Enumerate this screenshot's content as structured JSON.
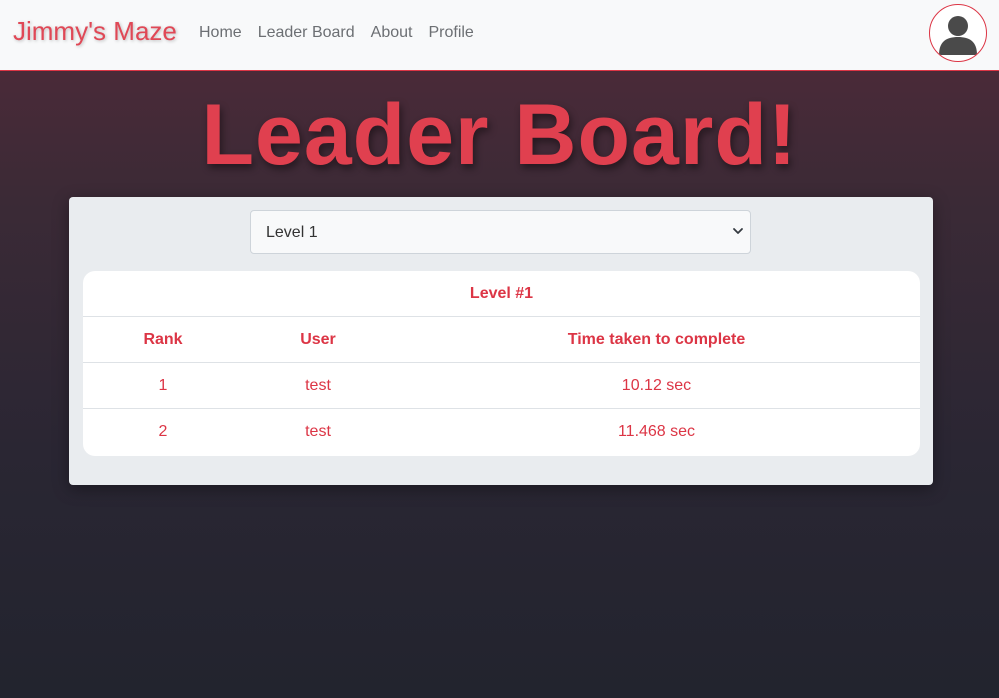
{
  "navbar": {
    "brand": "Jimmy's Maze",
    "links": [
      "Home",
      "Leader Board",
      "About",
      "Profile"
    ]
  },
  "page": {
    "title": "Leader Board!"
  },
  "level_select": {
    "selected": "Level 1"
  },
  "leaderboard": {
    "caption": "Level #1",
    "columns": [
      "Rank",
      "User",
      "Time taken to complete"
    ],
    "rows": [
      {
        "rank": "1",
        "user": "test",
        "time": "10.12 sec"
      },
      {
        "rank": "2",
        "user": "test",
        "time": "11.468 sec"
      }
    ]
  },
  "colors": {
    "accent": "#dc3545",
    "navbar_bg": "#f8f9fa",
    "panel_bg": "#e9ecef"
  },
  "icons": {
    "avatar": "user-avatar-icon",
    "select": "chevron-down-icon"
  }
}
